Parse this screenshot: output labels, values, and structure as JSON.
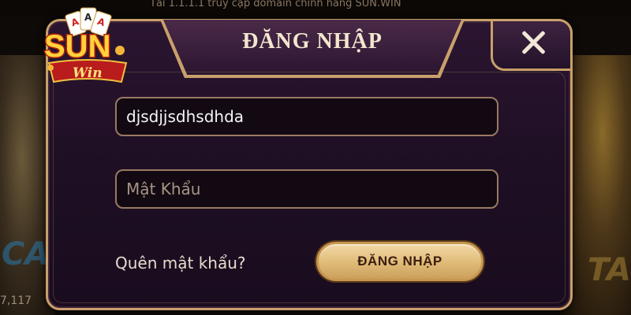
{
  "background": {
    "banner_text": "Tải 1.1.1.1 truy cập domain chính hãng SUN.WIN",
    "counter_text": "7,117"
  },
  "logo": {
    "brand": "SUN",
    "sub": "Win",
    "icon": "sunwin-logo-icon"
  },
  "dialog": {
    "title": "ĐĂNG NHẬP",
    "close_icon": "close-icon",
    "username": {
      "value": "djsdjjsdhsdhda",
      "placeholder": ""
    },
    "password": {
      "value": "",
      "placeholder": "Mật Khẩu"
    },
    "forgot_label": "Quên mật khẩu?",
    "login_label": "ĐĂNG NHẬP"
  },
  "colors": {
    "frame_gold": "#c9a06a",
    "panel_purple": "#2b1530",
    "button_gold": "#e2bd7a",
    "button_text": "#3a1e10"
  }
}
